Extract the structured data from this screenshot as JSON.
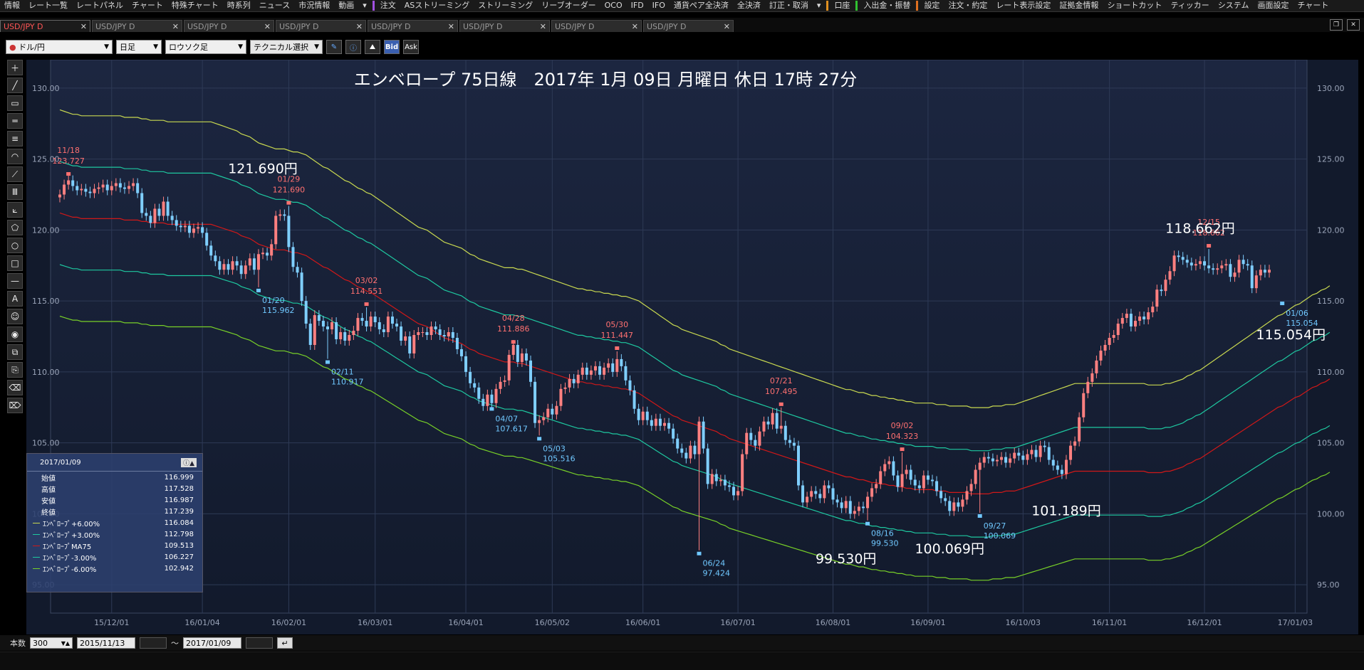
{
  "menu": [
    "情報",
    "レート一覧",
    "レートパネル",
    "チャート",
    "特殊チャート",
    "時系列",
    "ニュース",
    "市況情報",
    "動画",
    "▾",
    "注文",
    "ASストリーミング",
    "ストリーミング",
    "リーブオーダー",
    "OCO",
    "IFD",
    "IFO",
    "通貨ペア全決済",
    "全決済",
    "訂正・取消",
    "▾",
    "口座",
    "入出金・振替",
    "設定",
    "注文・約定",
    "レート表示設定",
    "証拠金情報",
    "ショートカット",
    "ティッカー",
    "システム",
    "画面設定",
    "チャート"
  ],
  "tabs": [
    {
      "label": "USD/JPY D",
      "active": true
    },
    {
      "label": "USD/JPY D",
      "active": false
    },
    {
      "label": "USD/JPY D",
      "active": false
    },
    {
      "label": "USD/JPY D",
      "active": false
    },
    {
      "label": "USD/JPY D",
      "active": false
    },
    {
      "label": "USD/JPY D",
      "active": false
    },
    {
      "label": "USD/JPY D",
      "active": false
    },
    {
      "label": "USD/JPY D",
      "active": false
    }
  ],
  "toolbar": {
    "pair": "ドル/円",
    "period": "日足",
    "chart_type": "ロウソク足",
    "technical": "テクニカル選択",
    "bid": "Bid",
    "ask": "Ask"
  },
  "tools": [
    "crosshair-tool",
    "line-tool",
    "ruler-tool",
    "hline-tool",
    "fib-tool",
    "arc-tool",
    "fan-tool",
    "channel-tool",
    "pitchfork-tool",
    "pentagon-tool",
    "circle-tool",
    "rect-tool",
    "separator-tool",
    "text-tool",
    "icon-tool",
    "magnet-tool",
    "copy-tool",
    "lock-tool",
    "eraser-tool",
    "erase-all-tool"
  ],
  "tool_glyphs": [
    "＋",
    "╱",
    "▭",
    "═",
    "≡",
    "◠",
    "⟋",
    "Ⅲ",
    "⟀",
    "⬠",
    "○",
    "□",
    "—",
    "A",
    "☺",
    "◉",
    "⧉",
    "⎘",
    "⌫",
    "⌦"
  ],
  "chart_data": {
    "type": "line",
    "title": "エンベロープ 75日線　2017年 1月 09日 月曜日 休日 17時 27分",
    "ylim": [
      93,
      132
    ],
    "yticks": [
      "130.00",
      "125.00",
      "120.00",
      "115.00",
      "110.00",
      "105.00",
      "100.00",
      "95.00"
    ],
    "ytick_values": [
      130,
      125,
      120,
      115,
      110,
      105,
      100,
      95
    ],
    "xticks": [
      "15/12/01",
      "16/01/04",
      "16/02/01",
      "16/03/01",
      "16/04/01",
      "16/05/02",
      "16/06/01",
      "16/07/01",
      "16/08/01",
      "16/09/01",
      "16/10/03",
      "16/11/01",
      "16/12/01",
      "17/01/03"
    ],
    "xtick_index": [
      12,
      33,
      53,
      73,
      94,
      114,
      135,
      157,
      179,
      201,
      223,
      243,
      265,
      286
    ],
    "n_bars": 300,
    "close": [
      122.5,
      123.2,
      123.5,
      123.1,
      122.8,
      122.9,
      122.7,
      122.6,
      122.9,
      123.0,
      123.2,
      122.8,
      123.1,
      123.3,
      123.0,
      122.9,
      123.1,
      123.3,
      122.6,
      121.2,
      121.0,
      120.5,
      121.5,
      121.0,
      122.0,
      121.0,
      120.7,
      120.3,
      120.2,
      120.3,
      119.8,
      120.1,
      120.2,
      119.8,
      118.9,
      118.2,
      117.8,
      117.2,
      117.6,
      117.2,
      117.8,
      117.5,
      116.9,
      117.5,
      118.0,
      117.2,
      118.3,
      118.4,
      118.2,
      119.0,
      121.0,
      121.1,
      121.0,
      118.8,
      117.4,
      117.0,
      115.0,
      113.4,
      111.9,
      114.0,
      113.6,
      113.2,
      113.0,
      113.5,
      112.3,
      112.8,
      112.2,
      112.6,
      112.9,
      113.8,
      113.6,
      113.2,
      113.9,
      113.5,
      113.0,
      112.8,
      113.9,
      113.4,
      113.2,
      112.2,
      112.5,
      111.3,
      112.6,
      112.8,
      112.8,
      112.6,
      113.2,
      113.0,
      112.6,
      112.5,
      112.8,
      112.4,
      111.6,
      111.1,
      110.0,
      109.2,
      108.9,
      108.1,
      107.6,
      108.4,
      107.8,
      108.8,
      109.3,
      109.4,
      111.2,
      111.9,
      110.7,
      111.3,
      110.8,
      109.3,
      106.4,
      106.6,
      106.8,
      107.4,
      107.0,
      107.6,
      108.8,
      108.9,
      109.5,
      109.2,
      109.8,
      110.3,
      109.8,
      110.1,
      110.4,
      109.8,
      110.3,
      110.6,
      110.0,
      110.9,
      110.4,
      109.4,
      108.7,
      107.4,
      106.6,
      107.2,
      106.6,
      106.2,
      106.7,
      106.2,
      106.4,
      106.0,
      105.3,
      104.6,
      104.3,
      103.9,
      104.8,
      104.2,
      106.5,
      104.6,
      102.1,
      102.8,
      102.3,
      102.4,
      102.0,
      101.9,
      101.3,
      101.6,
      104.2,
      105.7,
      105.2,
      104.8,
      105.8,
      106.5,
      106.3,
      107.1,
      106.0,
      106.2,
      105.2,
      105.0,
      104.8,
      102.0,
      100.8,
      101.2,
      101.6,
      101.4,
      101.1,
      102.0,
      101.8,
      101.0,
      100.8,
      100.4,
      100.9,
      100.0,
      100.2,
      100.5,
      100.4,
      101.2,
      101.8,
      102.1,
      103.0,
      103.5,
      103.7,
      102.7,
      101.9,
      102.8,
      103.1,
      102.4,
      102.0,
      101.8,
      102.7,
      102.4,
      102.3,
      101.6,
      101.1,
      100.9,
      100.2,
      100.8,
      100.5,
      101.0,
      101.6,
      102.1,
      103.1,
      103.6,
      104.0,
      103.9,
      103.7,
      103.8,
      104.0,
      103.6,
      103.9,
      104.3,
      104.1,
      103.8,
      104.2,
      104.5,
      104.0,
      104.8,
      104.7,
      103.8,
      103.4,
      103.1,
      102.8,
      103.8,
      104.8,
      105.1,
      106.8,
      108.5,
      109.3,
      109.9,
      110.8,
      111.5,
      111.9,
      112.4,
      112.6,
      113.4,
      113.8,
      114.1,
      113.2,
      113.6,
      113.9,
      113.7,
      114.2,
      114.6,
      115.8,
      115.7,
      116.5,
      117.1,
      118.2,
      118.1,
      117.9,
      117.7,
      117.5,
      117.6,
      117.8,
      117.5,
      117.3,
      117.2,
      117.3,
      117.5,
      117.6,
      116.7,
      117.0,
      117.9,
      117.6,
      117.5,
      115.9,
      116.8,
      117.2,
      117.0,
      117.2
    ],
    "envelope": {
      "ma75": [
        121.2,
        121.1,
        121.0,
        120.9,
        120.9,
        120.8,
        120.8,
        120.8,
        120.8,
        120.8,
        120.8,
        120.8,
        120.8,
        120.8,
        120.8,
        120.7,
        120.7,
        120.7,
        120.7,
        120.6,
        120.6,
        120.5,
        120.5,
        120.5,
        120.5,
        120.4,
        120.4,
        120.4,
        120.4,
        120.4,
        120.4,
        120.4,
        120.4,
        120.4,
        120.4,
        120.4,
        120.3,
        120.2,
        120.1,
        120.0,
        119.9,
        119.8,
        119.6,
        119.5,
        119.4,
        119.2,
        119.0,
        118.9,
        118.8,
        118.7,
        118.6,
        118.6,
        118.6,
        118.5,
        118.4,
        118.4,
        118.3,
        118.2,
        118.0,
        117.8,
        117.6,
        117.4,
        117.3,
        117.1,
        116.9,
        116.7,
        116.5,
        116.4,
        116.2,
        116.0,
        115.9,
        115.7,
        115.6,
        115.4,
        115.2,
        115.0,
        114.8,
        114.6,
        114.4,
        114.2,
        114.0,
        113.8,
        113.6,
        113.4,
        113.3,
        113.2,
        113.0,
        112.8,
        112.6,
        112.4,
        112.3,
        112.2,
        112.1,
        112.0,
        111.8,
        111.6,
        111.5,
        111.3,
        111.2,
        111.1,
        111.0,
        110.9,
        110.8,
        110.7,
        110.7,
        110.7,
        110.6,
        110.6,
        110.5,
        110.4,
        110.3,
        110.2,
        110.1,
        110.0,
        109.9,
        109.8,
        109.7,
        109.6,
        109.5,
        109.4,
        109.3,
        109.3,
        109.2,
        109.2,
        109.1,
        109.1,
        109.0,
        109.0,
        108.9,
        108.9,
        108.8,
        108.8,
        108.7,
        108.6,
        108.5,
        108.3,
        108.1,
        107.9,
        107.7,
        107.5,
        107.3,
        107.1,
        106.9,
        106.8,
        106.6,
        106.5,
        106.4,
        106.3,
        106.2,
        106.1,
        106.0,
        105.9,
        105.8,
        105.6,
        105.5,
        105.3,
        105.2,
        105.1,
        105.0,
        104.9,
        104.8,
        104.7,
        104.6,
        104.5,
        104.4,
        104.3,
        104.2,
        104.1,
        104.0,
        103.9,
        103.8,
        103.7,
        103.6,
        103.5,
        103.4,
        103.3,
        103.2,
        103.1,
        103.0,
        102.9,
        102.8,
        102.7,
        102.6,
        102.6,
        102.5,
        102.4,
        102.4,
        102.3,
        102.2,
        102.2,
        102.1,
        102.1,
        102.0,
        102.0,
        101.9,
        101.9,
        101.8,
        101.8,
        101.7,
        101.7,
        101.7,
        101.7,
        101.7,
        101.6,
        101.6,
        101.6,
        101.5,
        101.5,
        101.5,
        101.5,
        101.5,
        101.4,
        101.4,
        101.4,
        101.4,
        101.4,
        101.5,
        101.5,
        101.5,
        101.6,
        101.6,
        101.6,
        101.7,
        101.8,
        101.9,
        102.0,
        102.1,
        102.2,
        102.3,
        102.4,
        102.5,
        102.6,
        102.7,
        102.8,
        102.9,
        103.0,
        103.0,
        103.0,
        103.0,
        103.0,
        103.0,
        103.0,
        103.0,
        103.0,
        103.0,
        103.0,
        103.0,
        103.0,
        103.0,
        103.0,
        103.0,
        103.0,
        102.9,
        102.9,
        102.9,
        102.9,
        103.0,
        103.0,
        103.1,
        103.2,
        103.3,
        103.5,
        103.6,
        103.8,
        103.9,
        104.1,
        104.3,
        104.5,
        104.7,
        104.9,
        105.1,
        105.3,
        105.5,
        105.7,
        105.9,
        106.1,
        106.3,
        106.5,
        106.7,
        106.9,
        107.1,
        107.3,
        107.5,
        107.6,
        107.8,
        108.0,
        108.2,
        108.3,
        108.5,
        108.7,
        108.9,
        109.0,
        109.2,
        109.3,
        109.5
      ]
    },
    "envelope_pct": [
      6,
      3,
      0,
      -3,
      -6
    ],
    "envelope_colors": [
      "#c8d850",
      "#1ec8a0",
      "#d01818",
      "#1ec8a0",
      "#78d028"
    ],
    "candle_up_color": "#ff8080",
    "candle_down_color": "#7fcfff",
    "markers": [
      {
        "i": 2,
        "date": "11/18",
        "value": "123.727",
        "kind": "high"
      },
      {
        "i": 53,
        "date": "01/29",
        "value": "121.690",
        "kind": "high"
      },
      {
        "i": 46,
        "date": "01/20",
        "value": "115.962",
        "kind": "low"
      },
      {
        "i": 62,
        "date": "02/11",
        "value": "110.917",
        "kind": "low"
      },
      {
        "i": 71,
        "date": "03/02",
        "value": "114.551",
        "kind": "high"
      },
      {
        "i": 100,
        "date": "04/07",
        "value": "107.617",
        "kind": "low"
      },
      {
        "i": 105,
        "date": "04/28",
        "value": "111.886",
        "kind": "high"
      },
      {
        "i": 111,
        "date": "05/03",
        "value": "105.516",
        "kind": "low"
      },
      {
        "i": 129,
        "date": "05/30",
        "value": "111.447",
        "kind": "high"
      },
      {
        "i": 148,
        "date": "06/24",
        "value": "97.424",
        "kind": "low"
      },
      {
        "i": 167,
        "date": "07/21",
        "value": "107.495",
        "kind": "high"
      },
      {
        "i": 187,
        "date": "08/16",
        "value": "99.530",
        "kind": "low"
      },
      {
        "i": 195,
        "date": "09/02",
        "value": "104.323",
        "kind": "high"
      },
      {
        "i": 213,
        "date": "09/27",
        "value": "100.069",
        "kind": "low"
      },
      {
        "i": 266,
        "date": "12/15",
        "value": "118.662",
        "kind": "high"
      },
      {
        "i": 283,
        "date": "01/06",
        "value": "115.054",
        "kind": "low"
      }
    ],
    "callouts": [
      {
        "label": "121.690円",
        "i": 47,
        "value": 124.0
      },
      {
        "label": "118.662円",
        "i": 264,
        "value": 119.8
      },
      {
        "label": "115.054円",
        "i": 285,
        "value": 112.3
      },
      {
        "label": "101.189円",
        "i": 233,
        "value": 99.9
      },
      {
        "label": "100.069円",
        "i": 206,
        "value": 97.2
      },
      {
        "label": "99.530円",
        "i": 182,
        "value": 96.5
      }
    ]
  },
  "info_panel": {
    "date": "2017/01/09",
    "rows": [
      {
        "label": "始値",
        "value": "116.999"
      },
      {
        "label": "高値",
        "value": "117.528"
      },
      {
        "label": "安値",
        "value": "116.987"
      },
      {
        "label": "終値",
        "value": "117.239"
      }
    ],
    "env_rows": [
      {
        "label": "ｴﾝﾍﾞﾛｰﾌﾟ+6.00%",
        "value": "116.084",
        "color": "#c8d850"
      },
      {
        "label": "ｴﾝﾍﾞﾛｰﾌﾟ+3.00%",
        "value": "112.798",
        "color": "#1ec8a0"
      },
      {
        "label": "ｴﾝﾍﾞﾛｰﾌﾟMA75",
        "value": "109.513",
        "color": "#d01818"
      },
      {
        "label": "ｴﾝﾍﾞﾛｰﾌﾟ-3.00%",
        "value": "106.227",
        "color": "#1ec8a0"
      },
      {
        "label": "ｴﾝﾍﾞﾛｰﾌﾟ-6.00%",
        "value": "102.942",
        "color": "#78d028"
      }
    ]
  },
  "bottom": {
    "count_label": "本数",
    "count": "300",
    "from": "2015/11/13",
    "tilde": "～",
    "to": "2017/01/09"
  }
}
